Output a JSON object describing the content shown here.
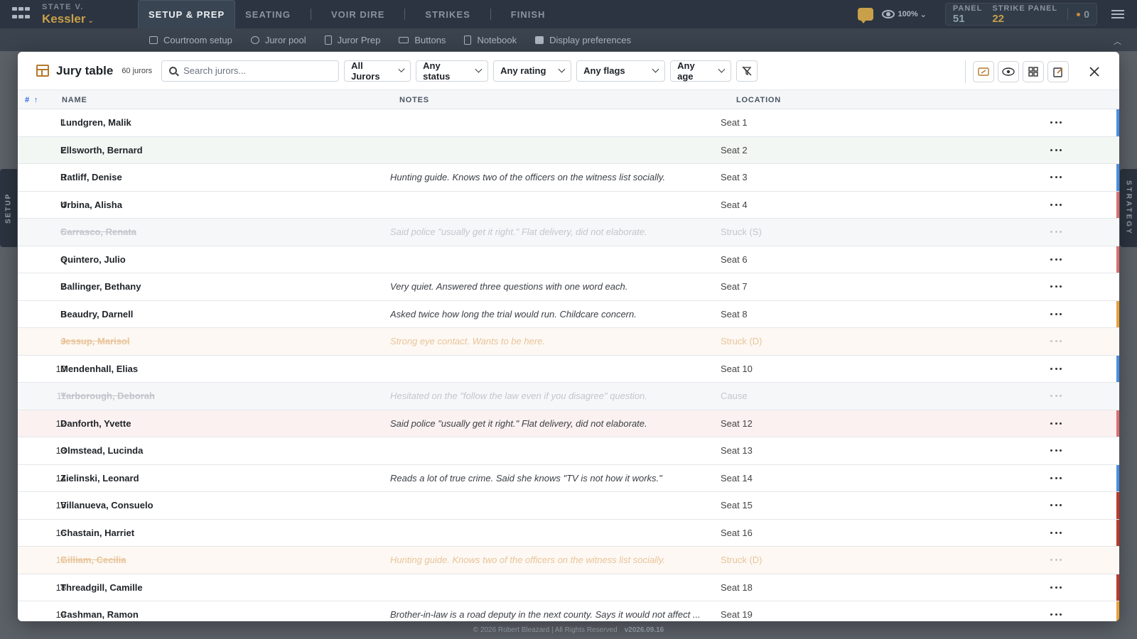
{
  "case": {
    "prefix": "STATE V.",
    "name": "Kessler"
  },
  "nav": {
    "tabs": [
      {
        "label": "SETUP & PREP",
        "active": true
      },
      {
        "label": "SEATING"
      },
      {
        "label": "VOIR DIRE"
      },
      {
        "label": "STRIKES"
      },
      {
        "label": "FINISH"
      }
    ]
  },
  "top": {
    "zoom": "100%",
    "panel_label": "PANEL",
    "panel_value": "51",
    "strike_label": "STRIKE PANEL",
    "strike_value": "22",
    "flag_count": "0"
  },
  "subnav": [
    {
      "label": "Courtroom setup",
      "icon": "sliders-icon"
    },
    {
      "label": "Juror pool",
      "icon": "users-icon"
    },
    {
      "label": "Juror Prep",
      "icon": "document-icon"
    },
    {
      "label": "Buttons",
      "icon": "button-icon"
    },
    {
      "label": "Notebook",
      "icon": "notebook-icon"
    },
    {
      "label": "Display preferences",
      "icon": "display-icon"
    }
  ],
  "side": {
    "left": "SETUP",
    "right": "STRATEGY"
  },
  "jury_table": {
    "title": "Jury table",
    "count": "60 jurors",
    "search_placeholder": "Search jurors...",
    "filters": {
      "jurors": "All Jurors",
      "status": "Any status",
      "rating": "Any rating",
      "flags": "Any flags",
      "age": "Any age"
    },
    "columns": {
      "num": "#",
      "name": "NAME",
      "notes": "NOTES",
      "location": "LOCATION"
    },
    "rows": [
      {
        "num": "1",
        "name": "Lundgren, Malik",
        "note": "",
        "loc": "Seat 1",
        "edge": "#4a8fe0",
        "shade": ""
      },
      {
        "num": "2",
        "name": "Ellsworth, Bernard",
        "note": "",
        "loc": "Seat 2",
        "edge": "",
        "shade": "green"
      },
      {
        "num": "3",
        "name": "Ratliff, Denise",
        "note": "Hunting guide. Knows two of the officers on the witness list socially.",
        "loc": "Seat 3",
        "edge": "#4a8fe0",
        "shade": ""
      },
      {
        "num": "4",
        "name": "Urbina, Alisha",
        "note": "",
        "loc": "Seat 4",
        "edge": "#d97070",
        "shade": ""
      },
      {
        "num": "5",
        "name": "Carrasco, Renata",
        "note": "Said police \"usually get it right.\" Flat delivery, did not elaborate.",
        "loc": "Struck (S)",
        "edge": "",
        "shade": "gray",
        "struck": true
      },
      {
        "num": "6",
        "name": "Quintero, Julio",
        "note": "",
        "loc": "Seat 6",
        "edge": "#d97070",
        "shade": ""
      },
      {
        "num": "7",
        "name": "Ballinger, Bethany",
        "note": "Very quiet. Answered three questions with one word each.",
        "loc": "Seat 7",
        "edge": "",
        "shade": ""
      },
      {
        "num": "8",
        "name": "Beaudry, Darnell",
        "note": "Asked twice how long the trial would run. Childcare concern.",
        "loc": "Seat 8",
        "edge": "#e8a23a",
        "shade": ""
      },
      {
        "num": "9",
        "name": "Jessup, Marisol",
        "note": "Strong eye contact. Wants to be here.",
        "loc": "Struck (D)",
        "edge": "",
        "shade": "cream",
        "struck": true
      },
      {
        "num": "10",
        "name": "Mendenhall, Elias",
        "note": "",
        "loc": "Seat 10",
        "edge": "#4a8fe0",
        "shade": ""
      },
      {
        "num": "11",
        "name": "Yarborough, Deborah",
        "note": "Hesitated on the \"follow the law even if you disagree\" question.",
        "loc": "Cause",
        "edge": "",
        "shade": "gray",
        "struck": true
      },
      {
        "num": "12",
        "name": "Danforth, Yvette",
        "note": "Said police \"usually get it right.\" Flat delivery, did not elaborate.",
        "loc": "Seat 12",
        "edge": "#d97070",
        "shade": "pink"
      },
      {
        "num": "13",
        "name": "Olmstead, Lucinda",
        "note": "",
        "loc": "Seat 13",
        "edge": "",
        "shade": ""
      },
      {
        "num": "14",
        "name": "Zielinski, Leonard",
        "note": "Reads a lot of true crime. Said she knows \"TV is not how it works.\"",
        "loc": "Seat 14",
        "edge": "#4a8fe0",
        "shade": ""
      },
      {
        "num": "15",
        "name": "Villanueva, Consuelo",
        "note": "",
        "loc": "Seat 15",
        "edge": "#c0392b",
        "shade": ""
      },
      {
        "num": "16",
        "name": "Chastain, Harriet",
        "note": "",
        "loc": "Seat 16",
        "edge": "#c0392b",
        "shade": ""
      },
      {
        "num": "17",
        "name": "Gilliam, Cecilia",
        "note": "Hunting guide. Knows two of the officers on the witness list socially.",
        "loc": "Struck (D)",
        "edge": "",
        "shade": "cream",
        "struck": true
      },
      {
        "num": "18",
        "name": "Threadgill, Camille",
        "note": "",
        "loc": "Seat 18",
        "edge": "#c0392b",
        "shade": ""
      },
      {
        "num": "19",
        "name": "Cashman, Ramon",
        "note": "Brother-in-law is a road deputy in the next county. Says it would not affect ...",
        "loc": "Seat 19",
        "edge": "#e8a23a",
        "shade": ""
      }
    ]
  },
  "footer": {
    "copyright": "© 2026 Robert Bleazard | All Rights Reserved",
    "version": "v2026.09.16"
  }
}
